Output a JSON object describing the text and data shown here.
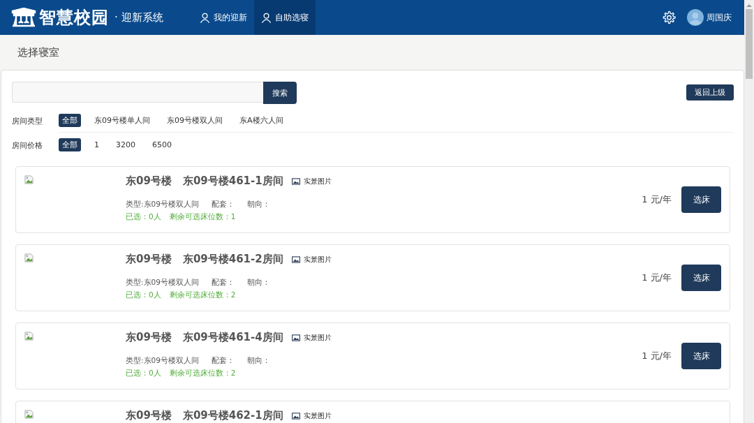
{
  "header": {
    "logo": "智慧校园",
    "subtitle": "· 迎新系统",
    "nav": [
      {
        "label": "我的迎新",
        "selected": false
      },
      {
        "label": "自助选寝",
        "selected": true
      }
    ],
    "user": "周国庆"
  },
  "page_title": "选择寝室",
  "search": {
    "button": "搜索"
  },
  "back_button": "返回上级",
  "filters": [
    {
      "label": "房间类型",
      "options": [
        {
          "label": "全部",
          "selected": true
        },
        {
          "label": "东09号楼单人间",
          "selected": false
        },
        {
          "label": "东09号楼双人间",
          "selected": false
        },
        {
          "label": "东A楼六人间",
          "selected": false
        }
      ]
    },
    {
      "label": "房间价格",
      "options": [
        {
          "label": "全部",
          "selected": true
        },
        {
          "label": "1",
          "selected": false
        },
        {
          "label": "3200",
          "selected": false
        },
        {
          "label": "6500",
          "selected": false
        }
      ]
    }
  ],
  "rooms": [
    {
      "building": "东09号楼",
      "room": "东09号楼461-1房间",
      "photo_label": "实景图片",
      "type": "类型:东09号楼双人间",
      "facilities": "配套：",
      "orientation": "朝向：",
      "selected_count": "已选：0人",
      "remaining": "剩余可选床位数：1",
      "price": "1 元/年",
      "button": "选床"
    },
    {
      "building": "东09号楼",
      "room": "东09号楼461-2房间",
      "photo_label": "实景图片",
      "type": "类型:东09号楼双人间",
      "facilities": "配套：",
      "orientation": "朝向：",
      "selected_count": "已选：0人",
      "remaining": "剩余可选床位数：2",
      "price": "1 元/年",
      "button": "选床"
    },
    {
      "building": "东09号楼",
      "room": "东09号楼461-4房间",
      "photo_label": "实景图片",
      "type": "类型:东09号楼双人间",
      "facilities": "配套：",
      "orientation": "朝向：",
      "selected_count": "已选：0人",
      "remaining": "剩余可选床位数：2",
      "price": "1 元/年",
      "button": "选床"
    },
    {
      "building": "东09号楼",
      "room": "东09号楼462-1房间",
      "photo_label": "实景图片"
    }
  ]
}
